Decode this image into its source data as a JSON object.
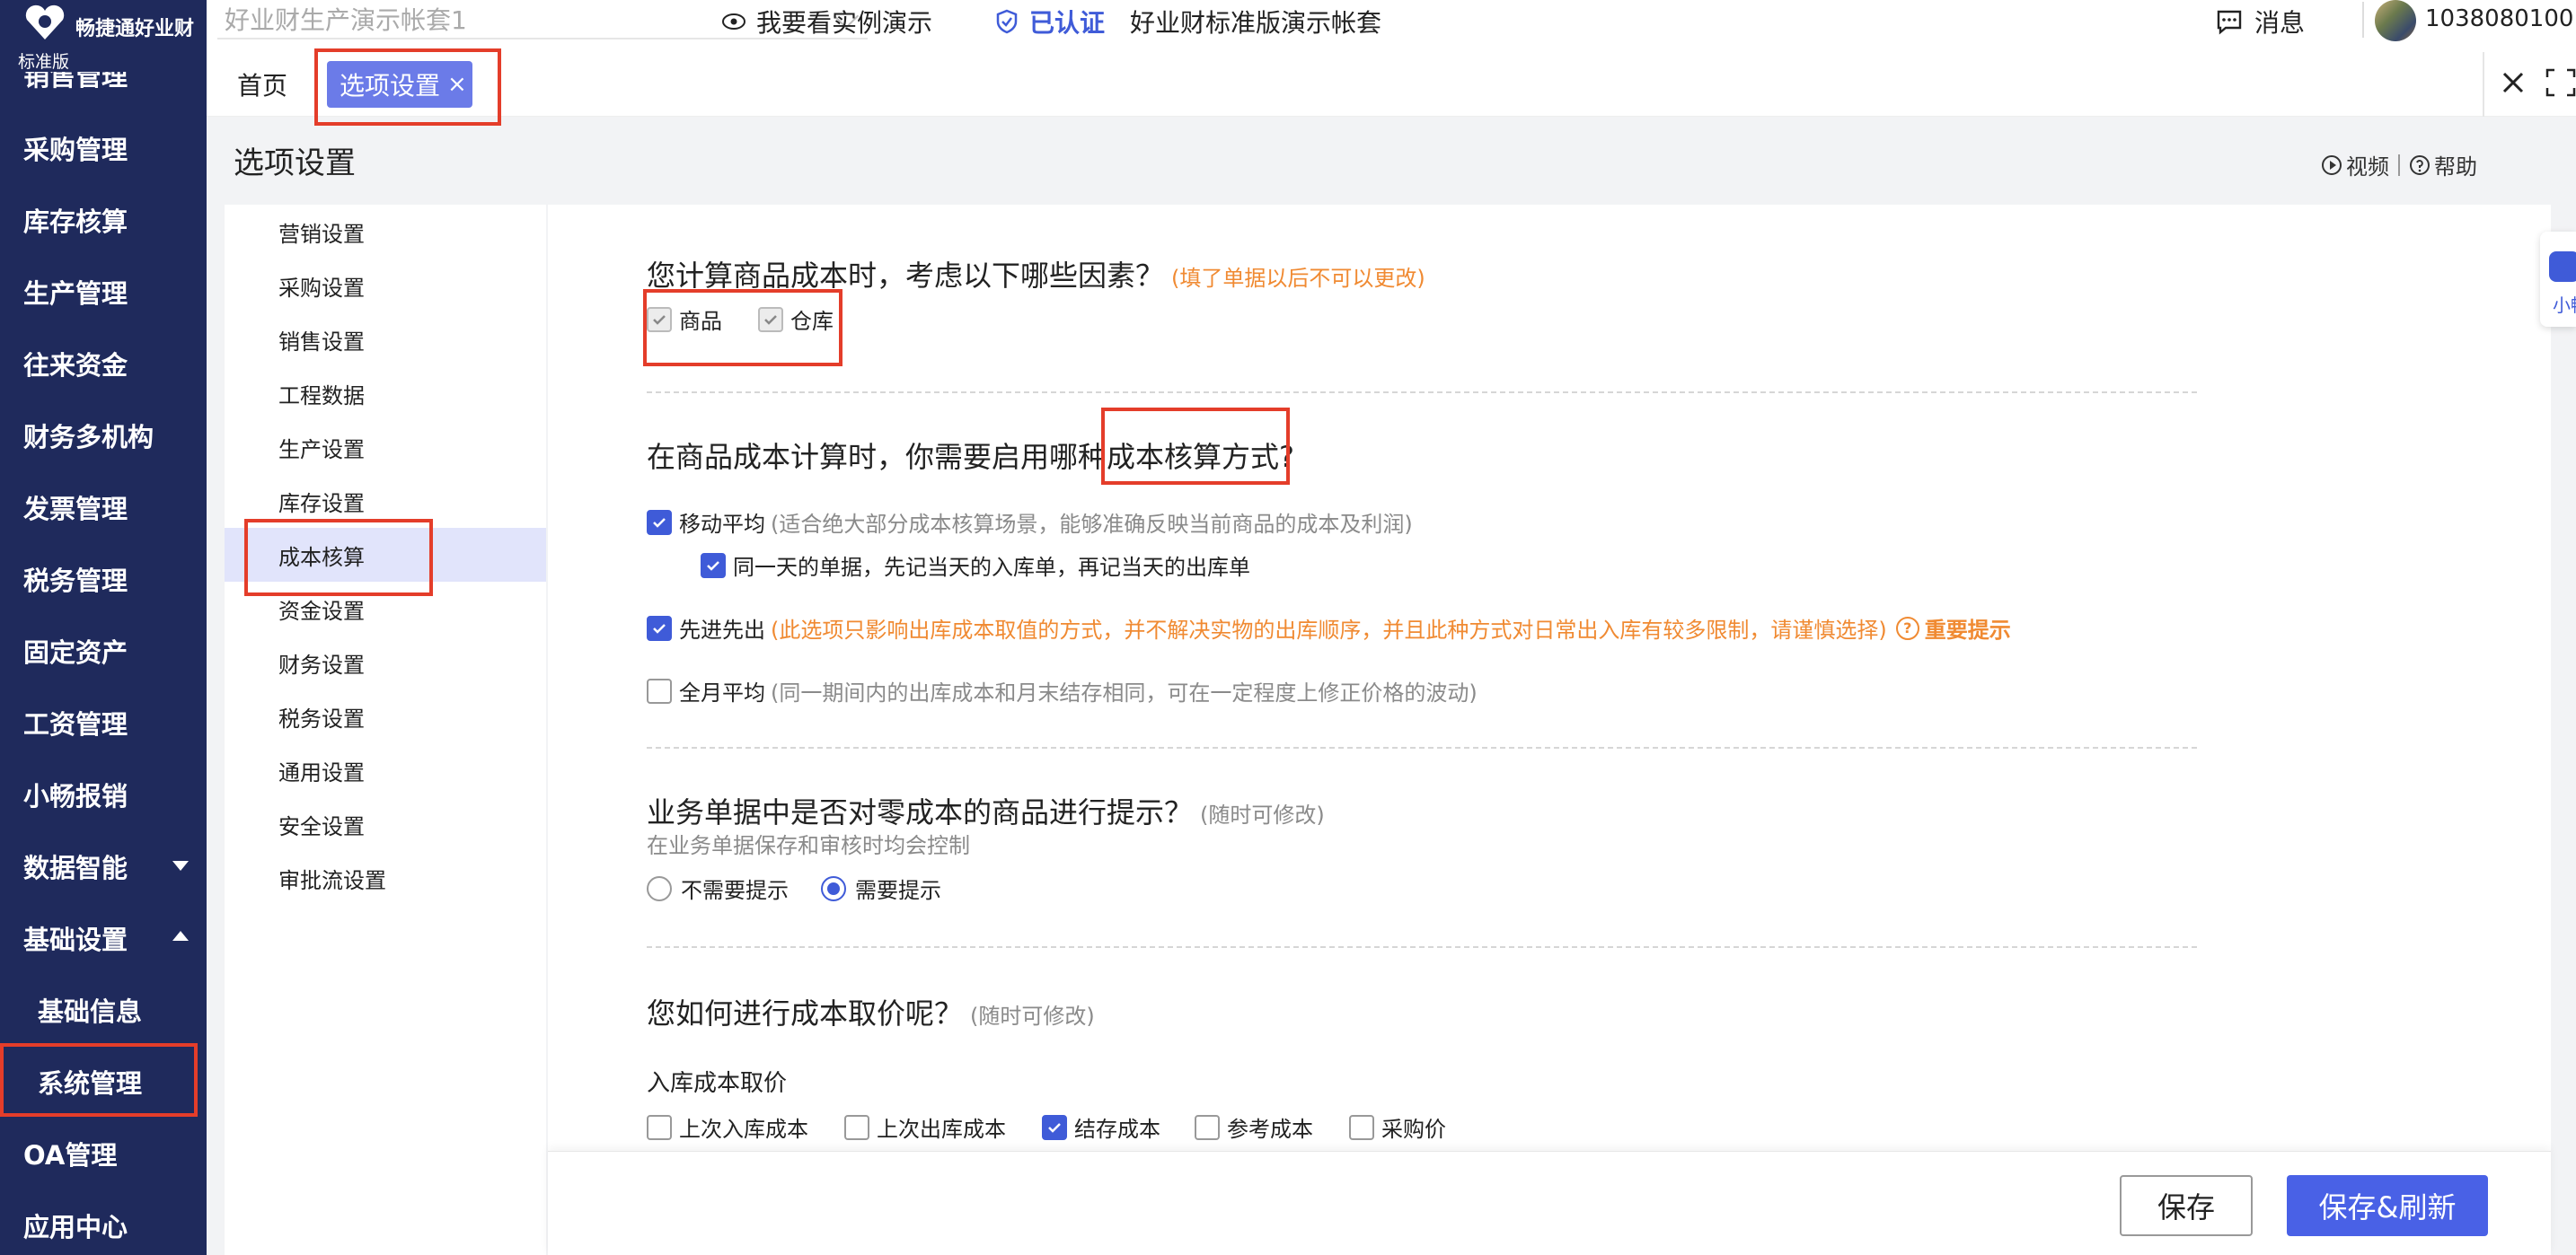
{
  "app": {
    "brand_name": "畅捷通好业财",
    "edition": "标准版"
  },
  "sidebar": {
    "partial_item": "销售管理",
    "items": [
      {
        "label": "采购管理"
      },
      {
        "label": "库存核算"
      },
      {
        "label": "生产管理"
      },
      {
        "label": "往来资金"
      },
      {
        "label": "财务多机构"
      },
      {
        "label": "发票管理"
      },
      {
        "label": "税务管理"
      },
      {
        "label": "固定资产"
      },
      {
        "label": "工资管理"
      },
      {
        "label": "小畅报销"
      },
      {
        "label": "数据智能"
      },
      {
        "label": "基础设置"
      },
      {
        "label": "基础信息"
      },
      {
        "label": "系统管理"
      },
      {
        "label": "OA管理"
      },
      {
        "label": "应用中心"
      }
    ]
  },
  "topbar": {
    "account_select_value": "好业财生产演示帐套1",
    "demo_link": "我要看实例演示",
    "verified": "已认证",
    "standard_account": "好业财标准版演示帐套",
    "messages": "消息",
    "user_id": "1038080100"
  },
  "tabs": {
    "home": "首页",
    "active": "选项设置",
    "active_close": "×"
  },
  "page": {
    "title": "选项设置",
    "video_link": "视频",
    "help_link": "帮助"
  },
  "submenu": {
    "items": [
      {
        "label": "营销设置"
      },
      {
        "label": "采购设置"
      },
      {
        "label": "销售设置"
      },
      {
        "label": "工程数据"
      },
      {
        "label": "生产设置"
      },
      {
        "label": "库存设置"
      },
      {
        "label": "成本核算"
      },
      {
        "label": "资金设置"
      },
      {
        "label": "财务设置"
      },
      {
        "label": "税务设置"
      },
      {
        "label": "通用设置"
      },
      {
        "label": "安全设置"
      },
      {
        "label": "审批流设置"
      }
    ],
    "active_index": 6
  },
  "section1": {
    "title": "您计算商品成本时，考虑以下哪些因素？",
    "note": "(填了单据以后不可以更改)",
    "options": [
      {
        "label": "商品",
        "checked": true
      },
      {
        "label": "仓库",
        "checked": true
      }
    ]
  },
  "section2": {
    "title_prefix": "在商品成本计算时，你需要启用哪种",
    "title_highlight": "成本核算方式",
    "title_suffix": "?",
    "moving_avg": {
      "label": "移动平均",
      "hint": "(适合绝大部分成本核算场景，能够准确反映当前商品的成本及利润)",
      "checked": true
    },
    "same_day": {
      "label": "同一天的单据，先记当天的入库单，再记当天的出库单",
      "checked": true
    },
    "fifo": {
      "label": "先进先出",
      "hint": "(此选项只影响出库成本取值的方式，并不解决实物的出库顺序，并且此种方式对日常出入库有较多限制，请谨慎选择)",
      "important": "重要提示",
      "checked": true
    },
    "monthly_avg": {
      "label": "全月平均",
      "hint": "(同一期间内的出库成本和月末结存相同，可在一定程度上修正价格的波动)",
      "checked": false
    }
  },
  "section3": {
    "title": "业务单据中是否对零成本的商品进行提示？",
    "note": "(随时可修改)",
    "subtitle": "在业务单据保存和审核时均会控制",
    "options": [
      {
        "label": "不需要提示",
        "selected": false
      },
      {
        "label": "需要提示",
        "selected": true
      }
    ]
  },
  "section4": {
    "title": "您如何进行成本取价呢？",
    "note": "(随时可修改)",
    "inbound_label": "入库成本取价",
    "options": [
      {
        "label": "上次入库成本",
        "checked": false
      },
      {
        "label": "上次出库成本",
        "checked": false
      },
      {
        "label": "结存成本",
        "checked": true
      },
      {
        "label": "参考成本",
        "checked": false
      },
      {
        "label": "采购价",
        "checked": false
      }
    ]
  },
  "footer": {
    "save": "保存",
    "save_refresh": "保存&刷新"
  },
  "float_widget": {
    "label": "小畅"
  },
  "colors": {
    "sidebar_bg": "#1f2a5c",
    "accent": "#3f5bd8",
    "primary_button": "#4961e6",
    "warning": "#f08a32",
    "annotation": "#e43d2a"
  }
}
